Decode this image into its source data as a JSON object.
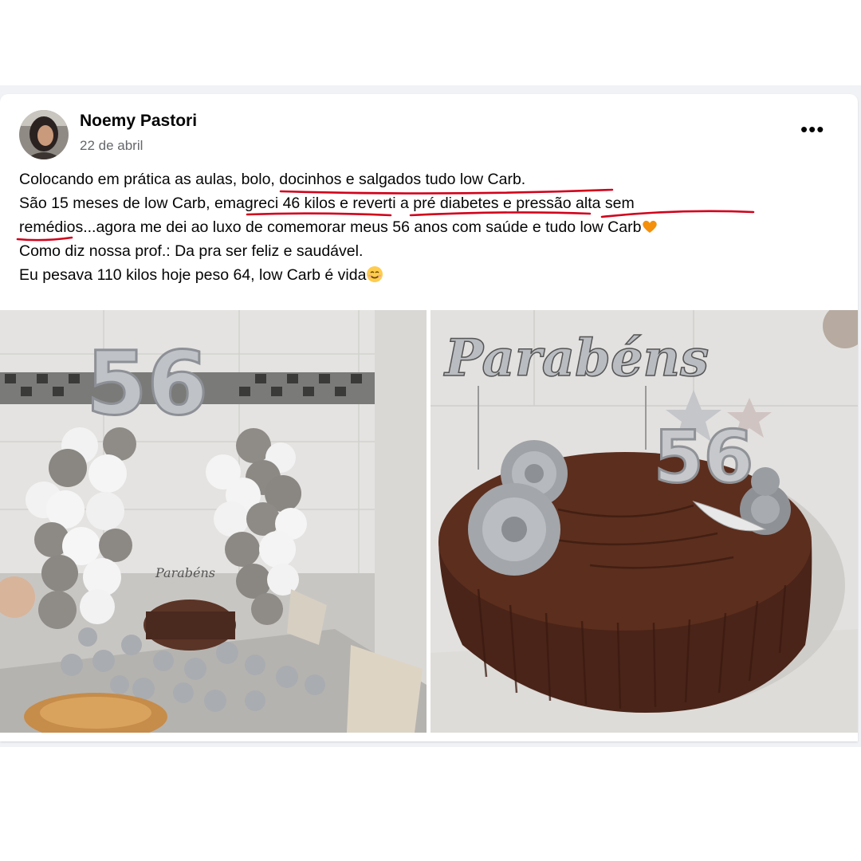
{
  "post": {
    "author": "Noemy Pastori",
    "date": "22 de abril",
    "more_icon": "more-horizontal-icon",
    "lines": [
      "Colocando em prática as aulas, bolo, docinhos e salgados tudo low Carb.",
      "São 15 meses de low Carb, emagreci 46 kilos e reverti a pré diabetes e pressão alta sem",
      "remédios...agora me dei ao luxo de comemorar meus 56 anos com saúde e tudo low Carb",
      "Como diz nossa prof.: Da pra ser feliz e saudável.",
      "Eu pesava 110 kilos hoje peso 64, low Carb é vida"
    ],
    "emojis": [
      "orange-heart-icon",
      "smiling-face-icon"
    ]
  },
  "photos": {
    "left": {
      "balloon_number": "56",
      "banner": "Parabéns"
    },
    "right": {
      "topper_text": "Parabéns",
      "candle_number": "56"
    }
  },
  "colors": {
    "annotation_red": "#d0021b",
    "name_text": "#050505",
    "meta_text": "#65676b",
    "background_band": "#f0f2f5"
  }
}
